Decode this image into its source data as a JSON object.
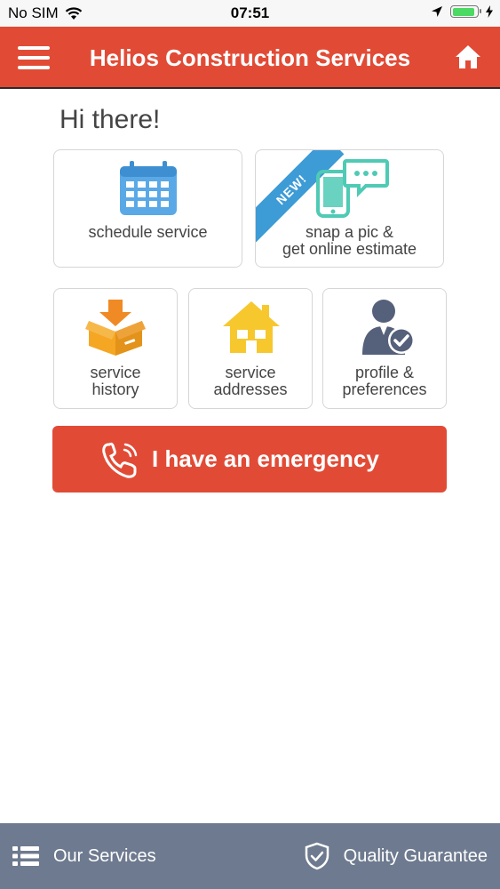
{
  "status_bar": {
    "carrier": "No SIM",
    "time": "07:51",
    "battery_level": 0.9
  },
  "header": {
    "title": "Helios Construction Services",
    "menu_icon": "hamburger-menu-icon",
    "home_icon": "home-icon"
  },
  "greeting": "Hi there!",
  "tiles": {
    "schedule": {
      "label": "schedule service",
      "icon": "calendar-icon"
    },
    "estimate": {
      "label_line1": "snap a pic &",
      "label_line2": "get online estimate",
      "badge": "NEW!",
      "icon": "phone-chat-icon"
    },
    "history": {
      "label_line1": "service",
      "label_line2": "history",
      "icon": "box-icon"
    },
    "addresses": {
      "label_line1": "service",
      "label_line2": "addresses",
      "icon": "house-icon"
    },
    "profile": {
      "label_line1": "profile &",
      "label_line2": "preferences",
      "icon": "user-check-icon"
    }
  },
  "emergency": {
    "label": "I have an emergency",
    "icon": "phone-ringing-icon"
  },
  "bottom_bar": {
    "services_label": "Our Services",
    "quality_label": "Quality Guarantee"
  },
  "colors": {
    "brand_red": "#e14b36",
    "bottom_bar": "#6e7a8f",
    "accent_blue": "#3d9bd6",
    "accent_teal": "#4fcab5",
    "accent_orange": "#f5a623",
    "accent_yellow": "#f7c82e"
  }
}
